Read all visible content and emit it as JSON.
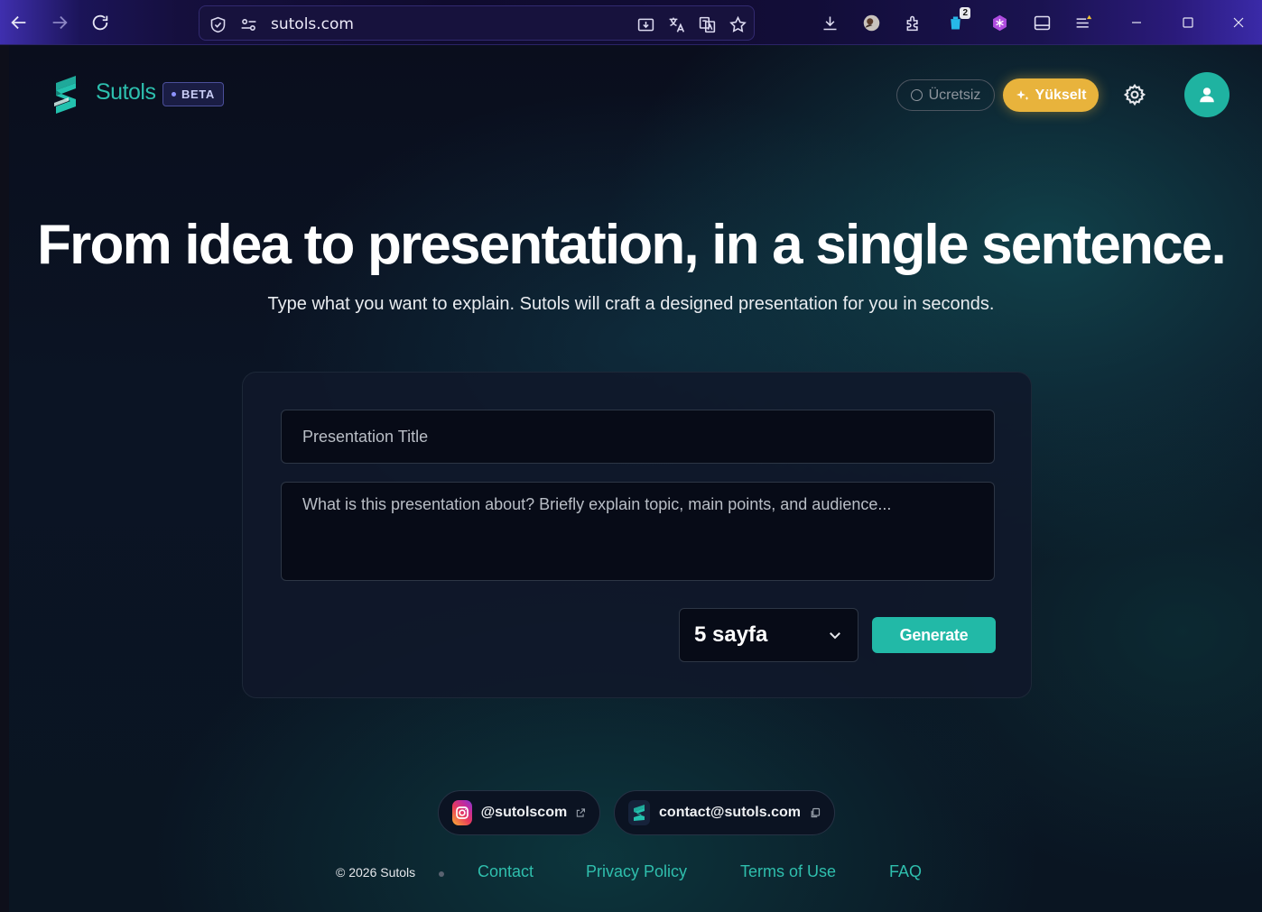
{
  "browser": {
    "url": "sutols.com",
    "extension_badge": "2"
  },
  "header": {
    "brand": "Sutols",
    "beta_label": "BETA",
    "plan_label": "Ücretsiz",
    "upgrade_label": "Yükselt"
  },
  "hero": {
    "title": "From idea to presentation, in a single sentence.",
    "subtitle": "Type what you want to explain. Sutols will craft a designed presentation for you in seconds."
  },
  "form": {
    "title_placeholder": "Presentation Title",
    "description_placeholder": "What is this presentation about? Briefly explain topic, main points, and audience...",
    "pages_selected": "5 sayfa",
    "generate_label": "Generate"
  },
  "social": {
    "instagram_handle": "@sutolscom",
    "email": "contact@sutols.com"
  },
  "footer": {
    "copyright": "© 2026 Sutols",
    "links": [
      "Contact",
      "Privacy Policy",
      "Terms of Use",
      "FAQ"
    ]
  },
  "colors": {
    "accent": "#22b9a7",
    "upgrade": "#e8b33c",
    "link": "#2fbfad"
  }
}
